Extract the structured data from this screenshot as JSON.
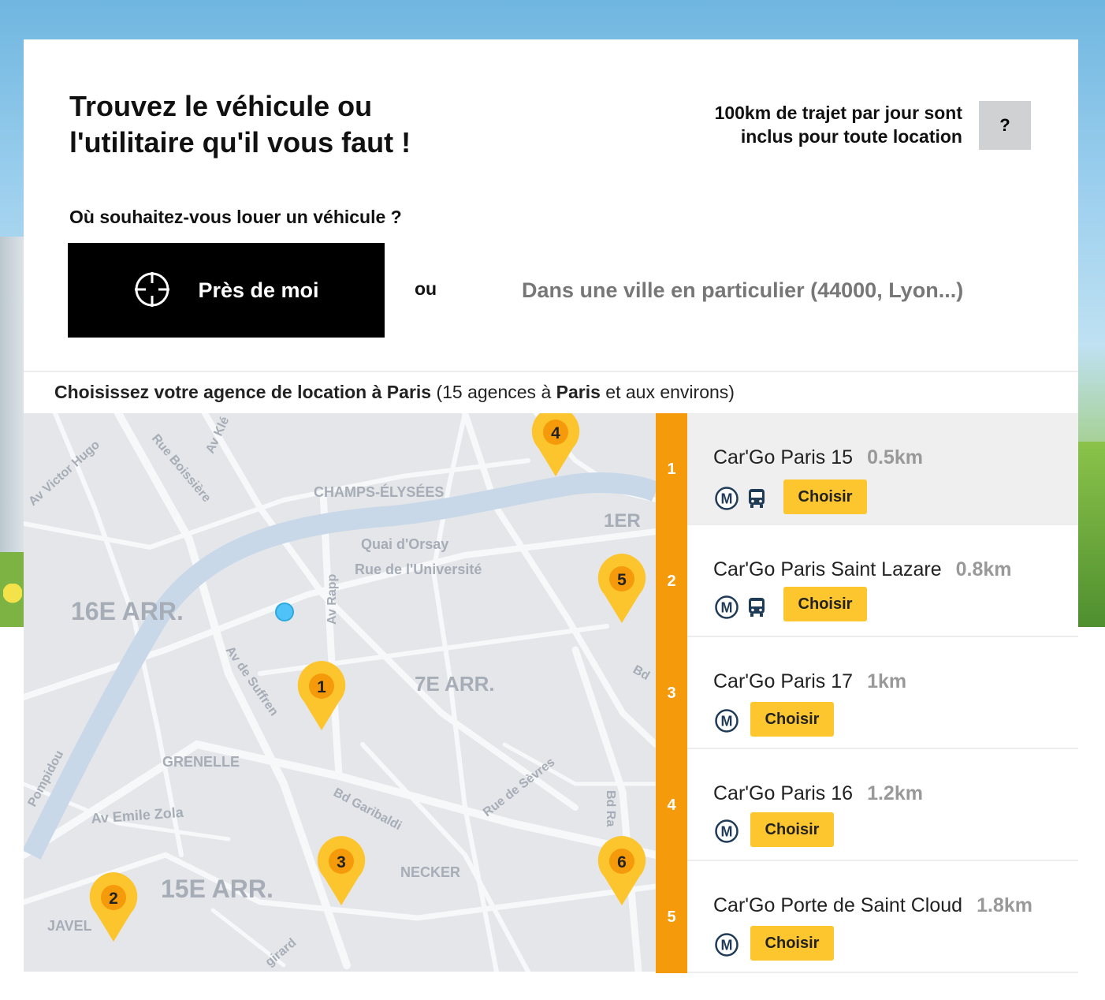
{
  "header": {
    "title_line1": "Trouvez le véhicule ou",
    "title_line2": "l'utilitaire qu'il vous faut !",
    "km_note_line1": "100km de trajet par jour sont",
    "km_note_line2": "inclus pour toute location",
    "help_label": "?"
  },
  "search": {
    "question": "Où souhaitez-vous louer un véhicule ?",
    "near_me_label": "Près de moi",
    "or_label": "ou",
    "city_placeholder": "Dans une ville en particulier (44000, Lyon...)"
  },
  "results_bar": {
    "prefix": "Choisissez votre agence de location à Paris",
    "count_open": "(15 agences à",
    "city": "Paris",
    "count_close": "et aux environs)"
  },
  "map": {
    "labels": {
      "av_victor_hugo": "Av Victor Hugo",
      "rue_boissiere": "Rue Boissière",
      "av_kleber": "Av Klé",
      "champs": "CHAMPS-ÉLYSÉES",
      "ier": "1ER",
      "quai_orsay": "Quai d'Orsay",
      "rue_universite": "Rue de l'Université",
      "arr16": "16E ARR.",
      "av_rapp": "Av Rapp",
      "av_suffren": "Av de Suffren",
      "arr7": "7E ARR.",
      "bd": "Bd",
      "grenelle": "GRENELLE",
      "pompidou": "Pompidou",
      "av_emile_zola": "Av Emile Zola",
      "bd_garibaldi": "Bd Garibaldi",
      "rue_sevres": "Rue de Sèvres",
      "bd_ra": "Bd Ra",
      "arr15": "15E ARR.",
      "necker": "NECKER",
      "javel": "JAVEL",
      "girard": "girard"
    },
    "pins": [
      "4",
      "5",
      "1",
      "3",
      "2",
      "6"
    ]
  },
  "agencies": [
    {
      "num": "1",
      "name": "Car'Go Paris 15",
      "distance": "0.5km",
      "icons": [
        "metro-icon",
        "bus-icon"
      ],
      "button": "Choisir"
    },
    {
      "num": "2",
      "name": "Car'Go Paris Saint Lazare",
      "distance": "0.8km",
      "icons": [
        "metro-icon",
        "bus-icon"
      ],
      "button": "Choisir"
    },
    {
      "num": "3",
      "name": "Car'Go Paris 17",
      "distance": "1km",
      "icons": [
        "metro-icon"
      ],
      "button": "Choisir"
    },
    {
      "num": "4",
      "name": "Car'Go Paris 16",
      "distance": "1.2km",
      "icons": [
        "metro-icon"
      ],
      "button": "Choisir"
    },
    {
      "num": "5",
      "name": "Car'Go Porte de Saint Cloud",
      "distance": "1.8km",
      "icons": [
        "metro-icon"
      ],
      "button": "Choisir"
    }
  ],
  "colors": {
    "accent_orange": "#f59a0a",
    "button_yellow": "#fdc62e",
    "pin_yellow": "#fcc52d",
    "pin_inner": "#f59a0a",
    "location_dot": "#4fc3f7",
    "river": "#c9d8e8"
  }
}
